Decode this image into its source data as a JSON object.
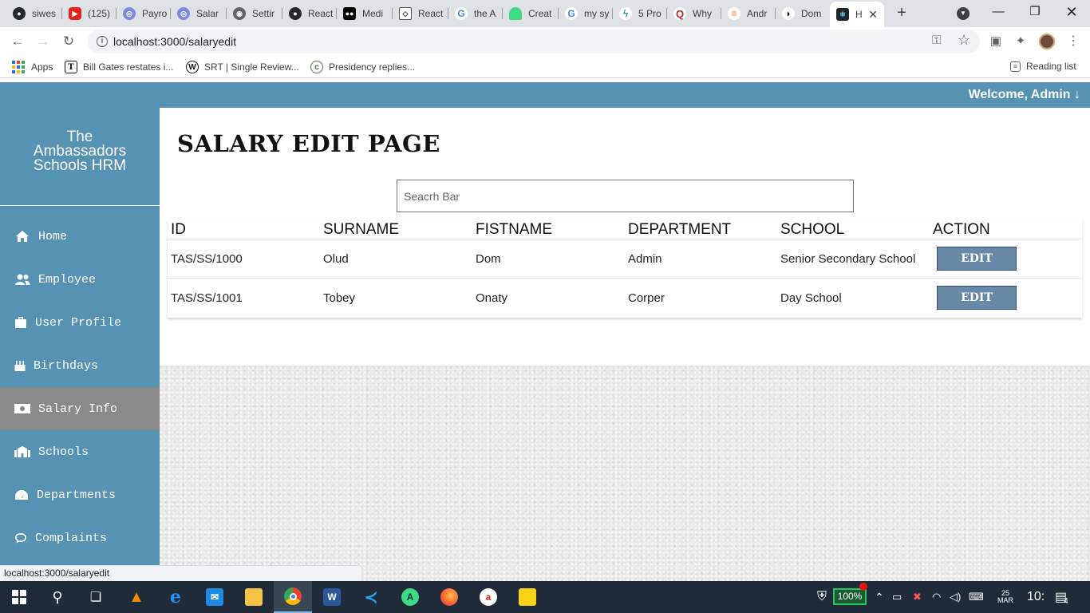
{
  "browser": {
    "tabs": [
      {
        "label": "siwes",
        "icon": "github-icon"
      },
      {
        "label": "(125)",
        "icon": "youtube-icon"
      },
      {
        "label": "Payro",
        "icon": "globe-icon"
      },
      {
        "label": "Salar",
        "icon": "globe-icon"
      },
      {
        "label": "Settir",
        "icon": "settings-globe-icon"
      },
      {
        "label": "React",
        "icon": "github-icon"
      },
      {
        "label": "Medi",
        "icon": "medium-icon"
      },
      {
        "label": "React",
        "icon": "react-diamond-icon"
      },
      {
        "label": "the A",
        "icon": "google-icon"
      },
      {
        "label": "Creat",
        "icon": "android-icon"
      },
      {
        "label": "my sy",
        "icon": "google-icon"
      },
      {
        "label": "5 Pro",
        "icon": "bolt-icon"
      },
      {
        "label": "Why",
        "icon": "quora-icon"
      },
      {
        "label": "Andr",
        "icon": "stackoverflow-icon"
      },
      {
        "label": "Dom",
        "icon": "rss-icon"
      },
      {
        "label": "H",
        "icon": "react-icon"
      }
    ],
    "url": "localhost:3000/salaryedit",
    "bookmarks": [
      {
        "label": "Apps"
      },
      {
        "label": "Bill Gates restates i..."
      },
      {
        "label": "SRT | Single Review..."
      },
      {
        "label": "Presidency replies..."
      }
    ],
    "reading_list": "Reading list",
    "status_url": "localhost:3000/salaryedit"
  },
  "app": {
    "welcome": "Welcome, Admin ↓",
    "brand": [
      "The",
      "Ambassadors",
      "Schools HRM"
    ],
    "nav": [
      {
        "label": "Home",
        "icon": "home-icon"
      },
      {
        "label": "Employee",
        "icon": "users-icon"
      },
      {
        "label": "User Profile",
        "icon": "briefcase-icon"
      },
      {
        "label": "Birthdays",
        "icon": "cake-icon"
      },
      {
        "label": "Salary Info",
        "icon": "money-bill-icon",
        "active": true
      },
      {
        "label": "Schools",
        "icon": "school-icon"
      },
      {
        "label": "Departments",
        "icon": "gauge-icon"
      },
      {
        "label": "Complaints",
        "icon": "comment-icon"
      }
    ],
    "page_title": "SALARY EDIT PAGE",
    "search_placeholder": "Seacrh Bar",
    "table": {
      "headers": [
        "ID",
        "SURNAME",
        "FISTNAME",
        "DEPARTMENT",
        "SCHOOL",
        "ACTION"
      ],
      "rows": [
        {
          "id": "TAS/SS/1000",
          "surname": "Olud",
          "firstname": "Dom",
          "department": "Admin",
          "school": "Senior Secondary School",
          "action": "EDIT"
        },
        {
          "id": "TAS/SS/1001",
          "surname": "Tobey",
          "firstname": "Onaty",
          "department": "Corper",
          "school": "Day School",
          "action": "EDIT"
        }
      ]
    }
  },
  "taskbar": {
    "battery": "100%",
    "date": [
      "25",
      "MAR"
    ],
    "time": "10:",
    "notifications": "4"
  }
}
